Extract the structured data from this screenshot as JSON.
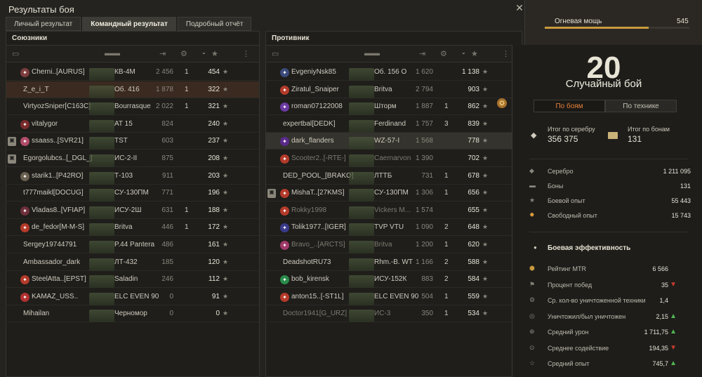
{
  "window": {
    "title": "Результаты боя"
  },
  "tabs": [
    "Личный результат",
    "Командный результат",
    "Подробный отчёт"
  ],
  "allies": {
    "header": "Союзники",
    "rows": [
      {
        "name": "Cherni..[AURUS]",
        "tank": "КВ-4М",
        "damage": "2 456",
        "kills": "1",
        "xp": "454",
        "clan_color": "#7d3d3d",
        "squad": false,
        "alive": true,
        "highlight": false
      },
      {
        "name": "Z_e_i_T",
        "tank": "Об. 416",
        "damage": "1 878",
        "kills": "1",
        "xp": "322",
        "clan_color": "",
        "squad": false,
        "alive": true,
        "highlight": true
      },
      {
        "name": "VirtyozSniper[C163C]",
        "tank": "Bourrasque",
        "damage": "2 022",
        "kills": "1",
        "xp": "321",
        "clan_color": "",
        "squad": false,
        "alive": true,
        "highlight": false
      },
      {
        "name": "vitalygor",
        "tank": "AT 15",
        "damage": "824",
        "kills": "",
        "xp": "240",
        "clan_color": "#7a2b2b",
        "squad": false,
        "alive": true,
        "highlight": false
      },
      {
        "name": "ssaass..[SVR21]",
        "tank": "TST",
        "damage": "603",
        "kills": "",
        "xp": "237",
        "clan_color": "#b04b6a",
        "squad": true,
        "alive": true,
        "highlight": false
      },
      {
        "name": "Egorgolubcs..[_DGL_]",
        "tank": "ИС-2-II",
        "damage": "875",
        "kills": "",
        "xp": "208",
        "clan_color": "",
        "squad": true,
        "alive": true,
        "highlight": false
      },
      {
        "name": "starik1..[P42RO]",
        "tank": "Т-103",
        "damage": "911",
        "kills": "",
        "xp": "203",
        "clan_color": "#6a6050",
        "squad": false,
        "alive": true,
        "highlight": false
      },
      {
        "name": "t777maikl[DOCUG]",
        "tank": "СУ-130ПМ",
        "damage": "771",
        "kills": "",
        "xp": "196",
        "clan_color": "",
        "squad": false,
        "alive": true,
        "highlight": false
      },
      {
        "name": "Vladas8..[VFIAP]",
        "tank": "ИСУ-2Ш",
        "damage": "631",
        "kills": "1",
        "xp": "188",
        "clan_color": "#6d2f3a",
        "squad": false,
        "alive": true,
        "highlight": false
      },
      {
        "name": "de_fedor[M-M-S]",
        "tank": "Britva",
        "damage": "446",
        "kills": "1",
        "xp": "172",
        "clan_color": "#b33a2a",
        "squad": false,
        "alive": true,
        "highlight": false
      },
      {
        "name": "Sergey19744791",
        "tank": "P.44 Pantera",
        "damage": "486",
        "kills": "",
        "xp": "161",
        "clan_color": "",
        "squad": false,
        "alive": true,
        "highlight": false
      },
      {
        "name": "Ambassador_dark",
        "tank": "ЛТ-432",
        "damage": "185",
        "kills": "",
        "xp": "120",
        "clan_color": "",
        "squad": false,
        "alive": true,
        "highlight": false
      },
      {
        "name": "SteelAtta..[EPST]",
        "tank": "Saladin",
        "damage": "246",
        "kills": "",
        "xp": "112",
        "clan_color": "#b33a2a",
        "squad": false,
        "alive": true,
        "highlight": false
      },
      {
        "name": "KAMAZ_USS..",
        "tank": "ELC EVEN 90",
        "damage": "0",
        "kills": "",
        "xp": "91",
        "clan_color": "#b03030",
        "squad": false,
        "alive": true,
        "highlight": false
      },
      {
        "name": "Mihailan",
        "tank": "Черномор",
        "damage": "0",
        "kills": "",
        "xp": "0",
        "clan_color": "",
        "squad": false,
        "alive": true,
        "highlight": false
      }
    ]
  },
  "enemy": {
    "header": "Противник",
    "rows": [
      {
        "name": "EvgeniyNsk85",
        "tank": "Об. 156 О",
        "damage": "1 620",
        "kills": "",
        "xp": "1 138",
        "clan_color": "#3a4a7a",
        "alive": true
      },
      {
        "name": "Ziratul_Snaiper",
        "tank": "Britva",
        "damage": "2 794",
        "kills": "",
        "xp": "903",
        "clan_color": "#b33a2a",
        "alive": true
      },
      {
        "name": "roman07122008",
        "tank": "Шторм",
        "damage": "1 887",
        "kills": "1",
        "xp": "862",
        "clan_color": "#6a3aa0",
        "alive": true
      },
      {
        "name": "expertbal[DEDK]",
        "tank": "Ferdinand",
        "damage": "1 757",
        "kills": "3",
        "xp": "839",
        "clan_color": "",
        "alive": true
      },
      {
        "name": "dark_flanders",
        "tank": "WZ-57-I",
        "damage": "1 568",
        "kills": "",
        "xp": "778",
        "clan_color": "#5a2a8a",
        "alive": true,
        "highlight": true
      },
      {
        "name": "Scooter2..[-RTE-]",
        "tank": "Caernarvon",
        "damage": "1 390",
        "kills": "",
        "xp": "702",
        "clan_color": "#b33a2a",
        "alive": false
      },
      {
        "name": "DED_POOL_[BRAKO]",
        "tank": "ЛТТБ",
        "damage": "731",
        "kills": "1",
        "xp": "678",
        "clan_color": "",
        "alive": true
      },
      {
        "name": "MishaT..[27KMS]",
        "tank": "СУ-130ПМ",
        "damage": "1 306",
        "kills": "1",
        "xp": "656",
        "clan_color": "#b33a2a",
        "squad": true,
        "alive": true
      },
      {
        "name": "Rokky1998",
        "tank": "Vickers M...",
        "damage": "1 574",
        "kills": "",
        "xp": "655",
        "clan_color": "#b33a2a",
        "alive": false
      },
      {
        "name": "Tolik1977..[IGER]",
        "tank": "TVP VTU",
        "damage": "1 090",
        "kills": "2",
        "xp": "648",
        "clan_color": "#3a3a8a",
        "alive": true
      },
      {
        "name": "Bravo_..[ARCTS]",
        "tank": "Britva",
        "damage": "1 200",
        "kills": "1",
        "xp": "620",
        "clan_color": "#a03a6a",
        "alive": false
      },
      {
        "name": "DeadshotRU73",
        "tank": "Rhm.-B. WT",
        "damage": "1 166",
        "kills": "2",
        "xp": "588",
        "clan_color": "",
        "alive": true
      },
      {
        "name": "bob_kirensk",
        "tank": "ИСУ-152К",
        "damage": "883",
        "kills": "2",
        "xp": "584",
        "clan_color": "#2a8a4a",
        "alive": true
      },
      {
        "name": "anton15..[-ST1L]",
        "tank": "ELC EVEN 90",
        "damage": "504",
        "kills": "1",
        "xp": "559",
        "clan_color": "#b33a2a",
        "alive": true
      },
      {
        "name": "Doctor1941[G_URZ]",
        "tank": "ИС-3",
        "damage": "350",
        "kills": "1",
        "xp": "534",
        "clan_color": "",
        "alive": false
      }
    ]
  },
  "side": {
    "firepower_label": "Огневая мощь",
    "firepower_value": "545",
    "firepower_fraction": 0.72,
    "battles_count": "20",
    "mode_title": "Случайный бой",
    "tab_by_battles": "По боям",
    "tab_by_vehicle": "По технике",
    "silver_total_label": "Итог по серебру",
    "silver_total": "356 375",
    "bonds_total_label": "Итог по бонам",
    "bonds_total": "131",
    "stats": [
      {
        "label": "Серебро",
        "value": "1 211 095"
      },
      {
        "label": "Боны",
        "value": "131"
      },
      {
        "label": "Боевой опыт",
        "value": "55 443"
      },
      {
        "label": "Свободный опыт",
        "value": "15 743"
      }
    ],
    "efficiency_title": "Боевая эффективность",
    "efficiency": [
      {
        "label": "Рейтинг MTR",
        "value": "6 566",
        "trend": ""
      },
      {
        "label": "Процент побед",
        "value": "35",
        "trend": "down"
      },
      {
        "label": "Ср. кол-во уничтоженной техники",
        "value": "1,4",
        "trend": ""
      },
      {
        "label": "Уничтожил/был уничтожен",
        "value": "2,15",
        "trend": "up"
      },
      {
        "label": "Средний урон",
        "value": "1 711,75",
        "trend": "up"
      },
      {
        "label": "Среднее содействие",
        "value": "194,35",
        "trend": "down"
      },
      {
        "label": "Средний опыт",
        "value": "745,7",
        "trend": "up"
      }
    ]
  }
}
